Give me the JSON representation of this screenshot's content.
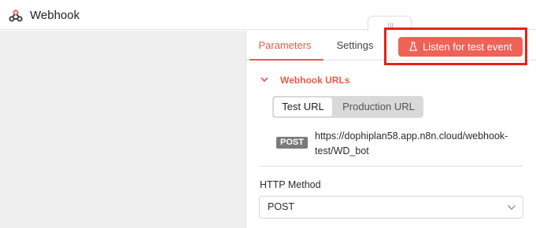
{
  "titlebar": {
    "title": "Webhook",
    "icon": "webhook-icon"
  },
  "tabs": [
    {
      "label": "Parameters",
      "active": true
    },
    {
      "label": "Settings",
      "active": false
    }
  ],
  "listen_button": {
    "label": "Listen for test event",
    "icon": "flask-icon"
  },
  "webhook_urls": {
    "title": "Webhook URLs",
    "toggle": {
      "options": [
        "Test URL",
        "Production URL"
      ],
      "selected": "Test URL"
    },
    "method_badge": "POST",
    "url": "https://dophiplan58.app.n8n.cloud/webhook-test/WD_bot"
  },
  "http_method": {
    "label": "HTTP Method",
    "value": "POST"
  },
  "colors": {
    "accent": "#ea5b4a",
    "button": "#ef6257",
    "highlight": "#e5221b",
    "left_pane": "#efefef"
  }
}
